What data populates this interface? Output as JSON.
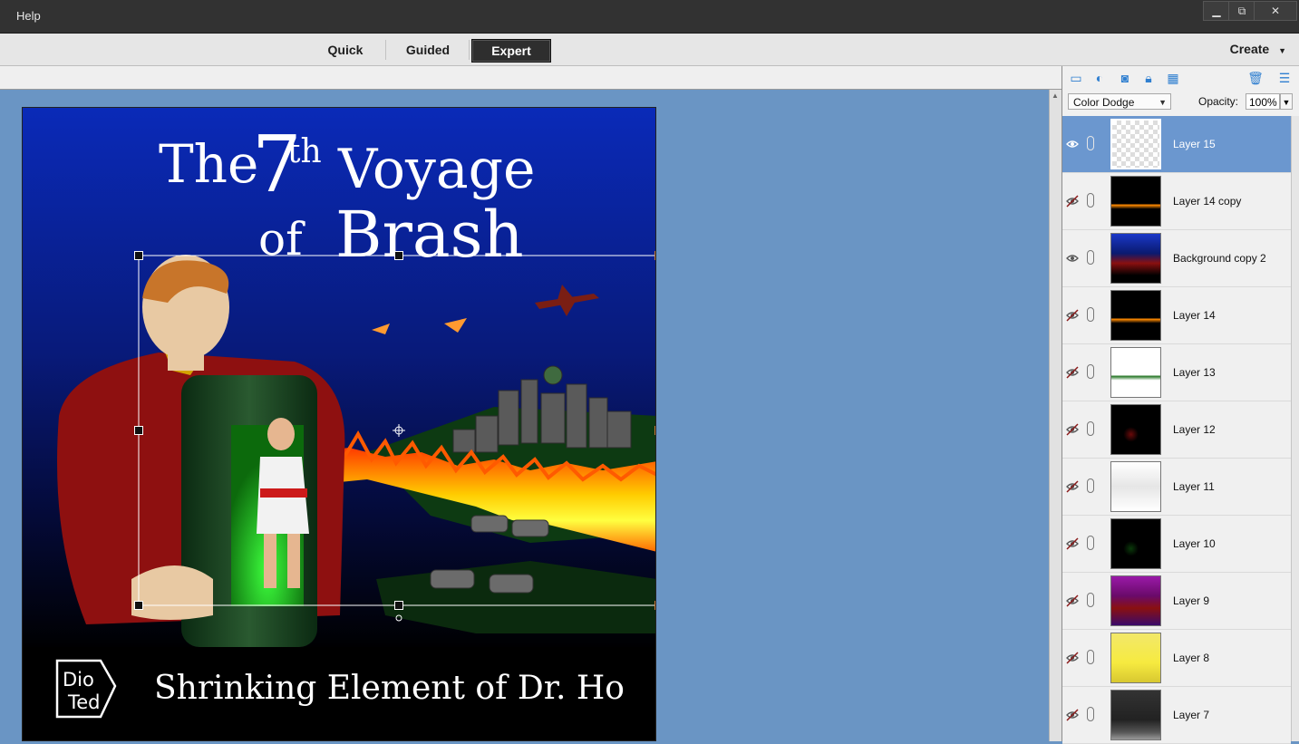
{
  "menu": {
    "help_label": "Help"
  },
  "window_controls": {
    "minimize": "▁",
    "restore": "⧉",
    "close": "✕"
  },
  "modes": {
    "quick": "Quick",
    "guided": "Guided",
    "expert": "Expert",
    "active": "Expert"
  },
  "create": {
    "label": "Create"
  },
  "panel": {
    "toolbar_icons": [
      "new-layer-icon",
      "adjustment-layer-icon",
      "layer-mask-icon",
      "lock-all-icon",
      "lock-transparency-icon",
      "trash-icon",
      "panel-menu-icon"
    ],
    "blend_mode": "Color Dodge",
    "opacity_label": "Opacity:",
    "opacity_value": "100%"
  },
  "layers": [
    {
      "name": "Layer 15",
      "visible": true,
      "selected": true,
      "thumb": "transparent-fire"
    },
    {
      "name": "Layer 14 copy",
      "visible": false,
      "selected": false,
      "thumb": "dark-fire"
    },
    {
      "name": "Background copy 2",
      "visible": true,
      "selected": false,
      "thumb": "full-cover"
    },
    {
      "name": "Layer 14",
      "visible": false,
      "selected": false,
      "thumb": "dark-fire"
    },
    {
      "name": "Layer 13",
      "visible": false,
      "selected": false,
      "thumb": "white-green"
    },
    {
      "name": "Layer 12",
      "visible": false,
      "selected": false,
      "thumb": "black-red"
    },
    {
      "name": "Layer 11",
      "visible": false,
      "selected": false,
      "thumb": "sketch"
    },
    {
      "name": "Layer 10",
      "visible": false,
      "selected": false,
      "thumb": "black-green"
    },
    {
      "name": "Layer 9",
      "visible": false,
      "selected": false,
      "thumb": "purple-cover"
    },
    {
      "name": "Layer 8",
      "visible": false,
      "selected": false,
      "thumb": "yellow-cover"
    },
    {
      "name": "Layer 7",
      "visible": false,
      "selected": false,
      "thumb": "gray-cover"
    }
  ],
  "artwork": {
    "title_the": "The",
    "title_7": "7",
    "title_th": "th",
    "title_voyage": "Voyage",
    "title_of": "of",
    "title_brash": "Brash",
    "subtitle": "Shrinking Element of Dr. Ho",
    "logo_line1": "Dio",
    "logo_line2": "Ted"
  }
}
